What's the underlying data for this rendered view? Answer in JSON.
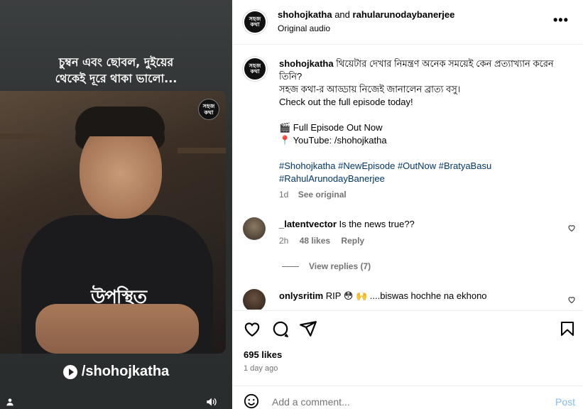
{
  "media": {
    "caption_line1": "চুম্বন এবং ছোবল, দুইয়ের",
    "caption_line2": "থেকেই দূরে থাকা ভালো...",
    "logo_text": "সহজ কথা",
    "shirt_text": "উপস্থিত",
    "youtube_handle": "/shohojkatha"
  },
  "header": {
    "user1": "shohojkatha",
    "and": "and",
    "user2": "rahularunodaybanerjee",
    "audio": "Original audio",
    "more": "•••",
    "avatar_text": "সহজ কথা"
  },
  "caption": {
    "username": "shohojkatha",
    "line1": "থিয়েটার দেখার নিমন্ত্রণ অনেক সময়েই কেন প্রত্যাখ্যান করেন তিনি?",
    "line2": "সহজ কথা-র আড্ডায় নিজেই জানালেন ব্রাত্য বসু।",
    "line3": "Check out the full episode today!",
    "line4": "🎬 Full Episode Out Now",
    "line5": "📍 YouTube: /shohojkatha",
    "hashtags1": "#Shohojkatha #NewEpisode #OutNow #BratyaBasu",
    "hashtags2": "#RahulArunodayBanerjee",
    "time": "1d",
    "see_original": "See original"
  },
  "comments": [
    {
      "username": "_latentvector",
      "text": "Is the news true??",
      "time": "2h",
      "likes": "48 likes",
      "reply": "Reply"
    },
    {
      "username": "onlysritim",
      "text": "RIP 😳 🙌 ....biswas hochhe na ekhono"
    }
  ],
  "view_replies": "View replies (7)",
  "likes": "695 likes",
  "date": "1 day ago",
  "add_comment": {
    "placeholder": "Add a comment...",
    "post": "Post"
  },
  "colors": {
    "link": "#00376b",
    "post_disabled": "#85b8f7",
    "meta": "#737373"
  },
  "icons": [
    "heart-icon",
    "comment-icon",
    "share-icon",
    "bookmark-icon",
    "emoji-icon",
    "sound-icon",
    "user-tag-icon",
    "youtube-icon"
  ]
}
